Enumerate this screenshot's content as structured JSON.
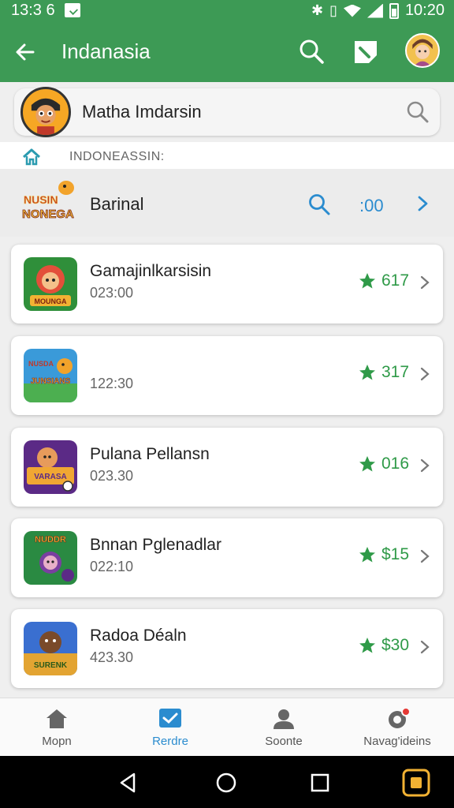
{
  "status_bar": {
    "time_left": "13:3 6",
    "time_right": "10:20"
  },
  "app_bar": {
    "title": "Indanasia",
    "back_icon": "arrow-left-icon",
    "search_icon": "search-icon",
    "edit_icon": "compose-icon",
    "avatar_icon": "avatar"
  },
  "search_card": {
    "name": "Matha Imdarsin",
    "icon": "search-icon"
  },
  "breadcrumb": {
    "home_icon": "home-icon",
    "text": "INDONEASSIN:"
  },
  "featured": {
    "logo_text": [
      "NUSIN",
      "NONEGA"
    ],
    "label": "Barinal",
    "count": ":00"
  },
  "items": [
    {
      "title": "Gamajinlkarsisin",
      "sub": "023:00",
      "rating": "617",
      "thumb_colors": [
        "#e34f3a",
        "#2f8f3a"
      ],
      "thumb_text": "MOUNGA"
    },
    {
      "title": "",
      "sub": "122:30",
      "rating": "317",
      "thumb_colors": [
        "#3a9ad9",
        "#f2b233"
      ],
      "thumb_text": "JUNSIANS"
    },
    {
      "title": "Pulana Pellansn",
      "sub": "023.30",
      "rating": "016",
      "thumb_colors": [
        "#5b2a86",
        "#f0a733"
      ],
      "thumb_text": "VARASA"
    },
    {
      "title": "Bnnan Pglenadlar",
      "sub": "022:10",
      "rating": "$15",
      "thumb_colors": [
        "#2a8a42",
        "#7a3fa0"
      ],
      "thumb_text": "NUDDR"
    },
    {
      "title": "Radoa Déaln",
      "sub": "423.30",
      "rating": "$30",
      "thumb_colors": [
        "#3a6fd0",
        "#e3a432"
      ],
      "thumb_text": "SURENK"
    }
  ],
  "bottom_nav": [
    {
      "label": "Mopn",
      "icon": "home-icon",
      "active": false
    },
    {
      "label": "Rerdre",
      "icon": "checkbox-icon",
      "active": true
    },
    {
      "label": "Soonte",
      "icon": "person-icon",
      "active": false
    },
    {
      "label": "Navag'ideins",
      "icon": "settings-badge-icon",
      "active": false
    }
  ],
  "system_nav": {
    "back": "triangle-back-icon",
    "home": "circle-home-icon",
    "recents": "square-recents-icon",
    "extra": "app-switch-icon"
  },
  "colors": {
    "primary": "#3d9a55",
    "accent": "#2b8ccf",
    "rating": "#2f9a48"
  }
}
